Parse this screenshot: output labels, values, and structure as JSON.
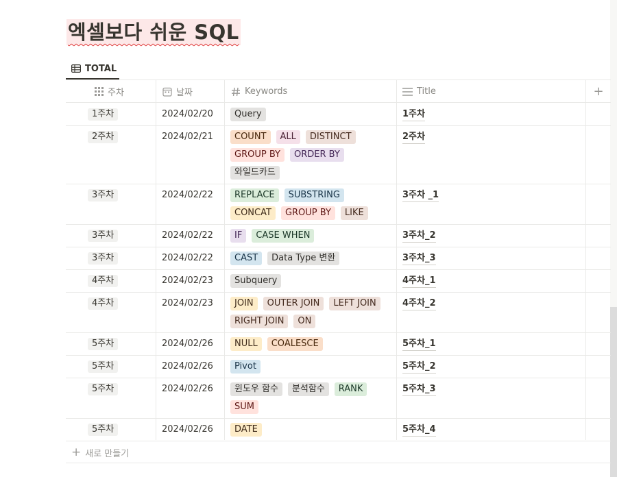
{
  "page": {
    "title": "엑셀보다 쉬운 SQL"
  },
  "view": {
    "tab_label": "TOTAL"
  },
  "columns": [
    {
      "label": "주차",
      "icon": "dots-grid-icon"
    },
    {
      "label": "날짜",
      "icon": "calendar-icon"
    },
    {
      "label": "Keywords",
      "icon": "hash-icon"
    },
    {
      "label": "Title",
      "icon": "text-lines-icon"
    }
  ],
  "add_column_label": "+",
  "tag_colors": {
    "gray": {
      "bg": "#e3e2e0",
      "fg": "#32302c"
    },
    "orange": {
      "bg": "#fadec9",
      "fg": "#49290e"
    },
    "pink": {
      "bg": "#f5e0e9",
      "fg": "#4c2337"
    },
    "brown": {
      "bg": "#eee0da",
      "fg": "#442a1e"
    },
    "red": {
      "bg": "#ffe2dd",
      "fg": "#5d1715"
    },
    "purple": {
      "bg": "#e8deee",
      "fg": "#412454"
    },
    "green": {
      "bg": "#dbeddb",
      "fg": "#1c3829"
    },
    "blue": {
      "bg": "#d3e5ef",
      "fg": "#183347"
    },
    "yellow": {
      "bg": "#fdecc8",
      "fg": "#402c1b"
    }
  },
  "rows": [
    {
      "week": "1주차",
      "date": "2024/02/20",
      "title": "1주차",
      "keywords": [
        {
          "text": "Query",
          "color": "gray"
        }
      ]
    },
    {
      "week": "2주차",
      "date": "2024/02/21",
      "title": "2주차",
      "keywords": [
        {
          "text": "COUNT",
          "color": "orange"
        },
        {
          "text": "ALL",
          "color": "pink"
        },
        {
          "text": "DISTINCT",
          "color": "brown"
        },
        {
          "text": "GROUP BY",
          "color": "red"
        },
        {
          "text": "ORDER BY",
          "color": "purple"
        },
        {
          "text": "와일드카드",
          "color": "gray"
        }
      ]
    },
    {
      "week": "3주차",
      "date": "2024/02/22",
      "title": "3주차 _1",
      "keywords": [
        {
          "text": "REPLACE",
          "color": "green"
        },
        {
          "text": "SUBSTRING",
          "color": "blue"
        },
        {
          "text": "CONCAT",
          "color": "yellow"
        },
        {
          "text": "GROUP BY",
          "color": "red"
        },
        {
          "text": "LIKE",
          "color": "brown"
        }
      ]
    },
    {
      "week": "3주차",
      "date": "2024/02/22",
      "title": "3주차_2",
      "keywords": [
        {
          "text": "IF",
          "color": "purple"
        },
        {
          "text": "CASE WHEN",
          "color": "green"
        }
      ]
    },
    {
      "week": "3주차",
      "date": "2024/02/22",
      "title": "3주차_3",
      "keywords": [
        {
          "text": "CAST",
          "color": "blue"
        },
        {
          "text": "Data Type 변환",
          "color": "gray"
        }
      ]
    },
    {
      "week": "4주차",
      "date": "2024/02/23",
      "title": "4주차_1",
      "keywords": [
        {
          "text": "Subquery",
          "color": "gray"
        }
      ]
    },
    {
      "week": "4주차",
      "date": "2024/02/23",
      "title": "4주차_2",
      "keywords": [
        {
          "text": "JOIN",
          "color": "yellow"
        },
        {
          "text": "OUTER JOIN",
          "color": "brown"
        },
        {
          "text": "LEFT JOIN",
          "color": "brown"
        },
        {
          "text": "RIGHT JOIN",
          "color": "brown"
        },
        {
          "text": "ON",
          "color": "brown"
        }
      ]
    },
    {
      "week": "5주차",
      "date": "2024/02/26",
      "title": "5주차_1",
      "keywords": [
        {
          "text": "NULL",
          "color": "yellow"
        },
        {
          "text": "COALESCE",
          "color": "orange"
        }
      ]
    },
    {
      "week": "5주차",
      "date": "2024/02/26",
      "title": "5주차_2",
      "keywords": [
        {
          "text": "Pivot",
          "color": "blue"
        }
      ]
    },
    {
      "week": "5주차",
      "date": "2024/02/26",
      "title": "5주차_3",
      "keywords": [
        {
          "text": "윈도우 함수",
          "color": "gray"
        },
        {
          "text": "분석함수",
          "color": "gray"
        },
        {
          "text": "RANK",
          "color": "green"
        },
        {
          "text": "SUM",
          "color": "red"
        }
      ]
    },
    {
      "week": "5주차",
      "date": "2024/02/26",
      "title": "5주차_4",
      "keywords": [
        {
          "text": "DATE",
          "color": "yellow"
        }
      ]
    }
  ],
  "new_row_label": "새로 만들기"
}
